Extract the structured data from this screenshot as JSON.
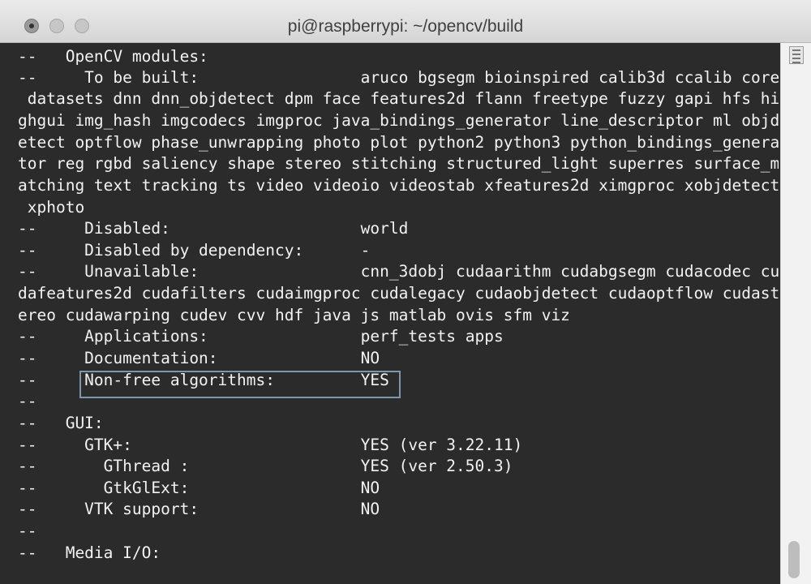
{
  "window": {
    "title": "pi@raspberrypi: ~/opencv/build"
  },
  "terminal": {
    "lines": [
      "--   OpenCV modules:",
      "--     To be built:                 aruco bgsegm bioinspired calib3d ccalib core",
      " datasets dnn dnn_objdetect dpm face features2d flann freetype fuzzy gapi hfs hi",
      "ghgui img_hash imgcodecs imgproc java_bindings_generator line_descriptor ml objd",
      "etect optflow phase_unwrapping photo plot python2 python3 python_bindings_genera",
      "tor reg rgbd saliency shape stereo stitching structured_light superres surface_m",
      "atching text tracking ts video videoio videostab xfeatures2d ximgproc xobjdetect",
      " xphoto",
      "--     Disabled:                    world",
      "--     Disabled by dependency:      -",
      "--     Unavailable:                 cnn_3dobj cudaarithm cudabgsegm cudacodec cu",
      "dafeatures2d cudafilters cudaimgproc cudalegacy cudaobjdetect cudaoptflow cudast",
      "ereo cudawarping cudev cvv hdf java js matlab ovis sfm viz",
      "--     Applications:                perf_tests apps",
      "--     Documentation:               NO",
      "--     Non-free algorithms:         YES",
      "--",
      "--   GUI:",
      "--     GTK+:                        YES (ver 3.22.11)",
      "--       GThread :                  YES (ver 2.50.3)",
      "--       GtkGlExt:                  NO",
      "--     VTK support:                 NO",
      "--",
      "--   Media I/O:"
    ]
  }
}
